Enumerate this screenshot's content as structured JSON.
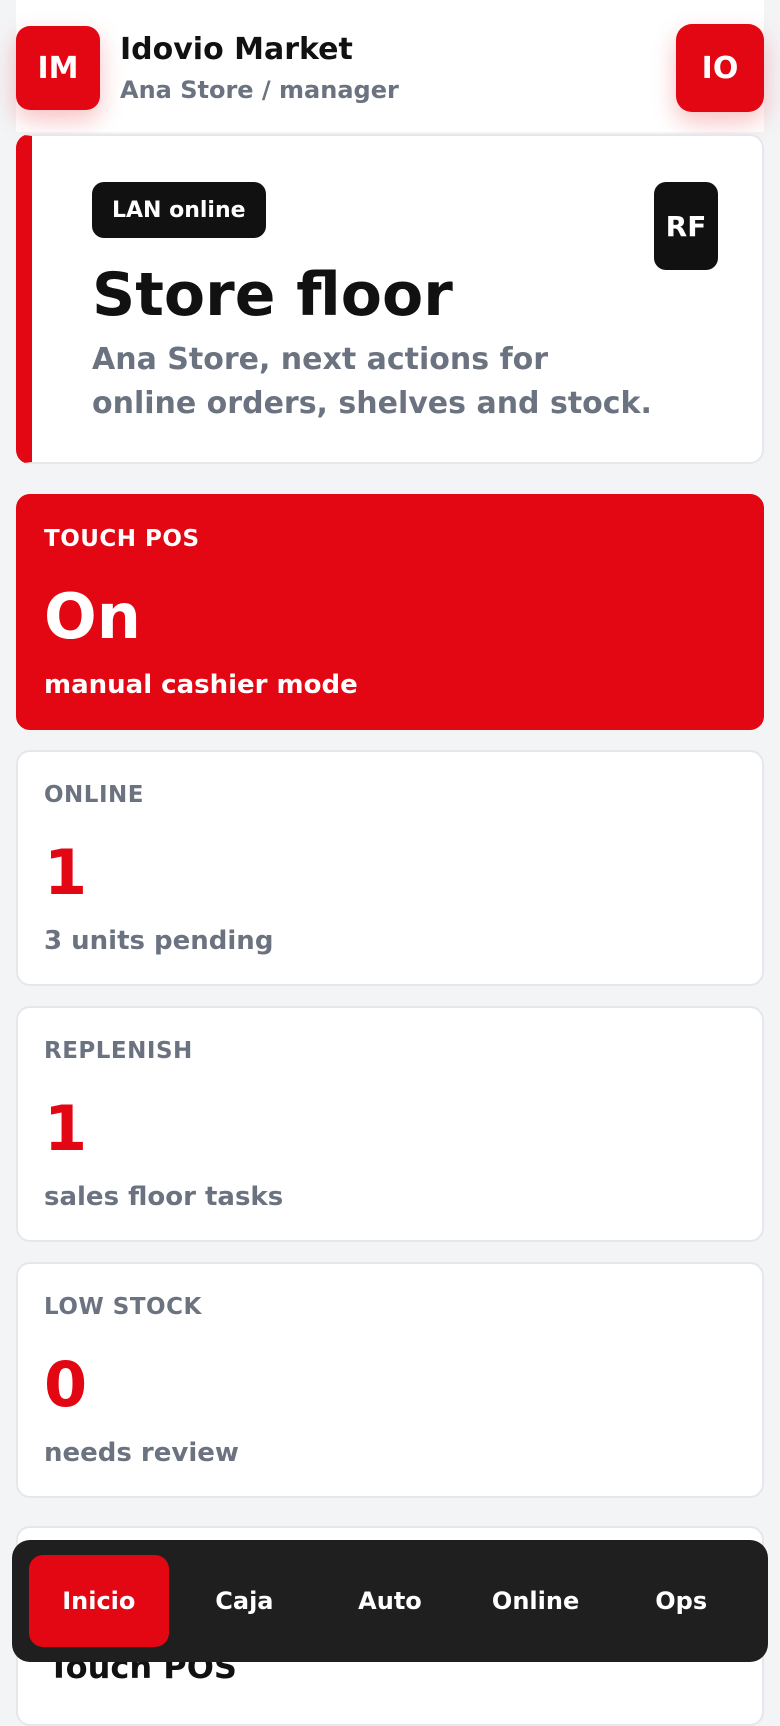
{
  "header": {
    "avatar_initials": "IM",
    "title": "Idovio Market",
    "subtitle": "Ana Store / manager",
    "user_initials": "IO"
  },
  "hero": {
    "badge": "LAN online",
    "corner_initials": "RF",
    "title": "Store floor",
    "description": "Ana Store, next actions for online orders, shelves and stock."
  },
  "cards": [
    {
      "label": "TOUCH POS",
      "value": "On",
      "sub": "manual cashier mode"
    },
    {
      "label": "ONLINE",
      "value": "1",
      "sub": "3 units pending"
    },
    {
      "label": "REPLENISH",
      "value": "1",
      "sub": "sales floor tasks"
    },
    {
      "label": "LOW STOCK",
      "value": "0",
      "sub": "needs review"
    }
  ],
  "peek": {
    "title": "Touch POS"
  },
  "nav": [
    {
      "label": "Inicio"
    },
    {
      "label": "Caja"
    },
    {
      "label": "Auto"
    },
    {
      "label": "Online"
    },
    {
      "label": "Ops"
    }
  ],
  "colors": {
    "accent": "#e30613",
    "dark": "#111111",
    "muted": "#6b7280"
  }
}
